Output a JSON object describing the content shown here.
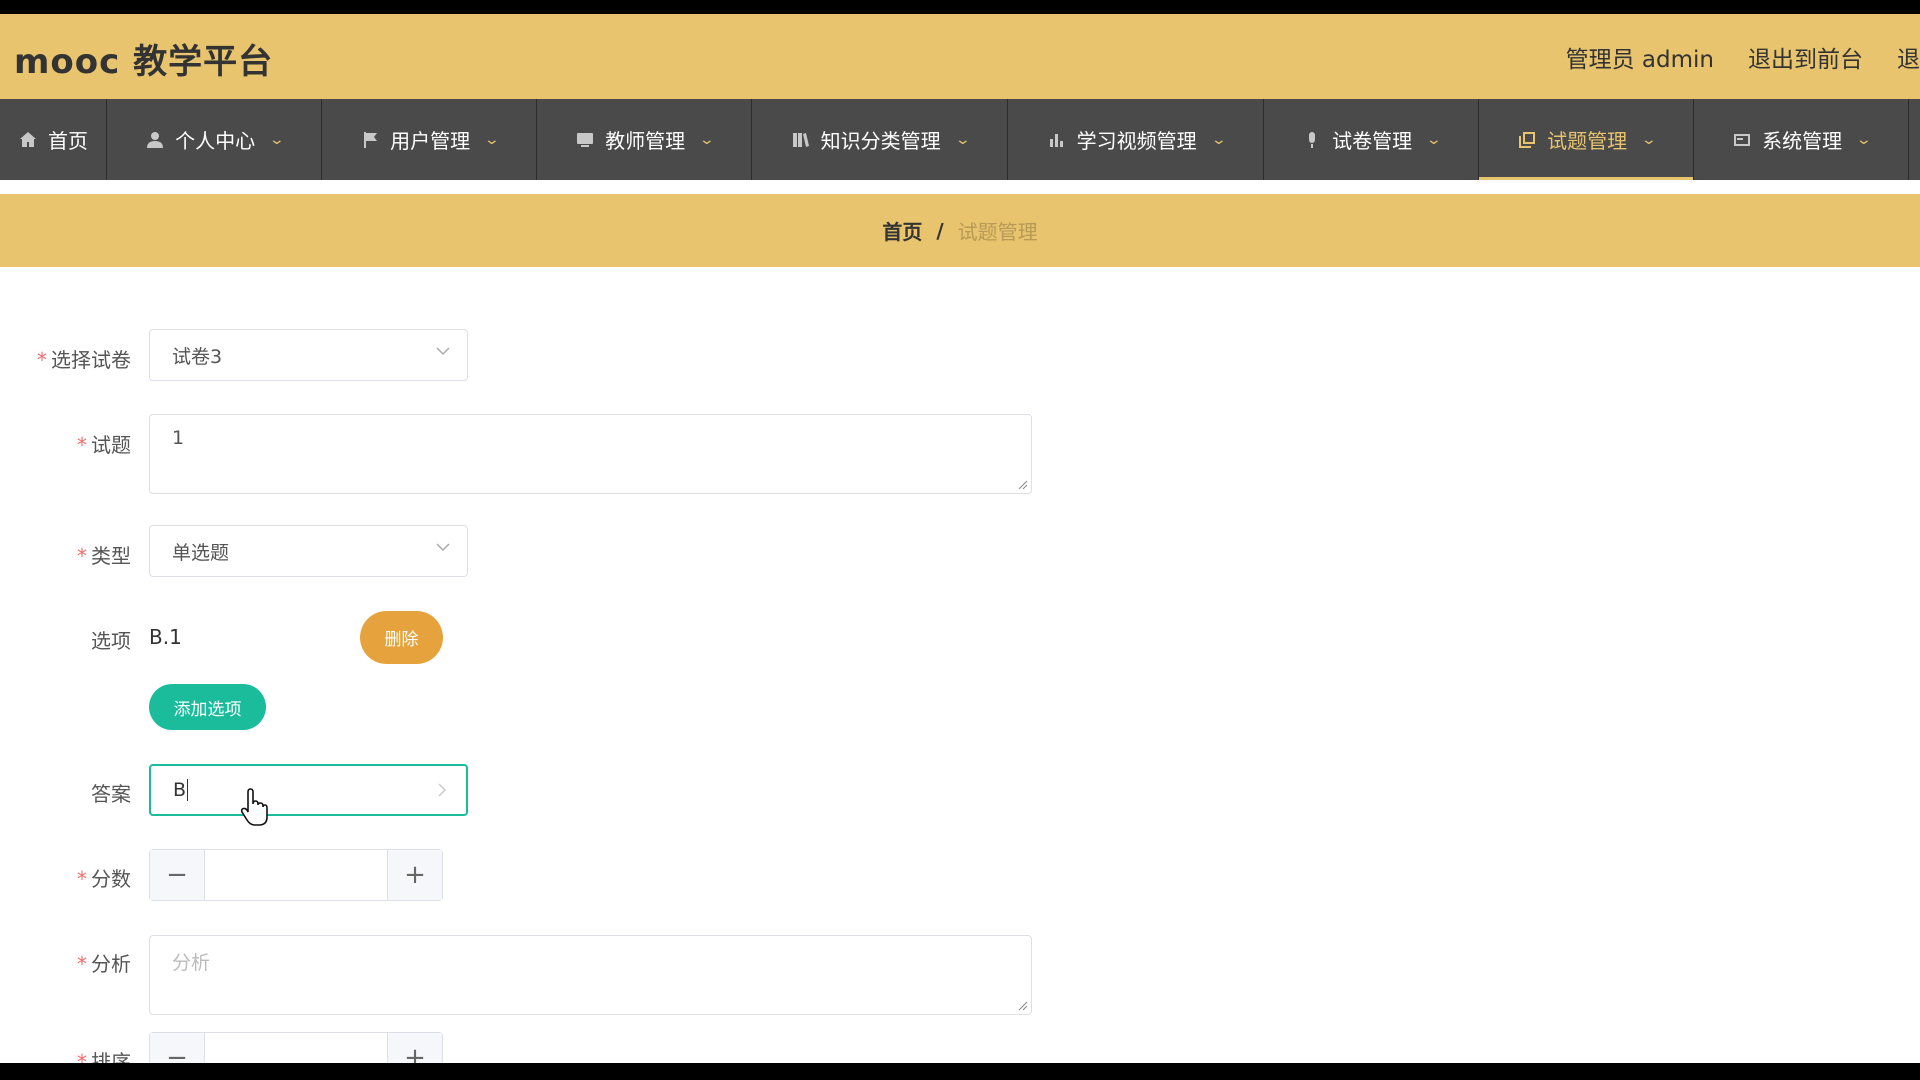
{
  "header": {
    "brand": "mooc 教学平台",
    "user": "管理员 admin",
    "to_front": "退出到前台",
    "logout": "退"
  },
  "nav": {
    "items": [
      {
        "label": "首页",
        "icon": "home-icon"
      },
      {
        "label": "个人中心",
        "icon": "user-icon"
      },
      {
        "label": "用户管理",
        "icon": "flag-icon"
      },
      {
        "label": "教师管理",
        "icon": "monitor-icon"
      },
      {
        "label": "知识分类管理",
        "icon": "books-icon"
      },
      {
        "label": "学习视频管理",
        "icon": "bar-chart-icon"
      },
      {
        "label": "试卷管理",
        "icon": "microphone-icon"
      },
      {
        "label": "试题管理",
        "icon": "copy-icon"
      },
      {
        "label": "系统管理",
        "icon": "card-icon"
      }
    ],
    "active": "试题管理",
    "caret": "⌄"
  },
  "breadcrumb": {
    "home": "首页",
    "separator": "/",
    "current": "试题管理"
  },
  "form": {
    "required_mark": "*",
    "paper": {
      "label": "选择试卷",
      "value": "试卷3"
    },
    "question": {
      "label": "试题",
      "value": "1"
    },
    "type": {
      "label": "类型",
      "value": "单选题"
    },
    "options": {
      "label": "选项",
      "items": [
        "B.1"
      ],
      "delete_label": "删除"
    },
    "add_option_label": "添加选项",
    "answer": {
      "label": "答案",
      "value": "B"
    },
    "score": {
      "label": "分数",
      "minus": "−",
      "plus": "+"
    },
    "analysis": {
      "label": "分析",
      "placeholder": "分析"
    },
    "order": {
      "label": "排序",
      "minus": "−",
      "plus": "+"
    }
  },
  "colors": {
    "header_bg": "#e7c46d",
    "nav_bg": "#4a4a4a",
    "delete_button": "#e6a23c",
    "add_button": "#1abc9c"
  }
}
